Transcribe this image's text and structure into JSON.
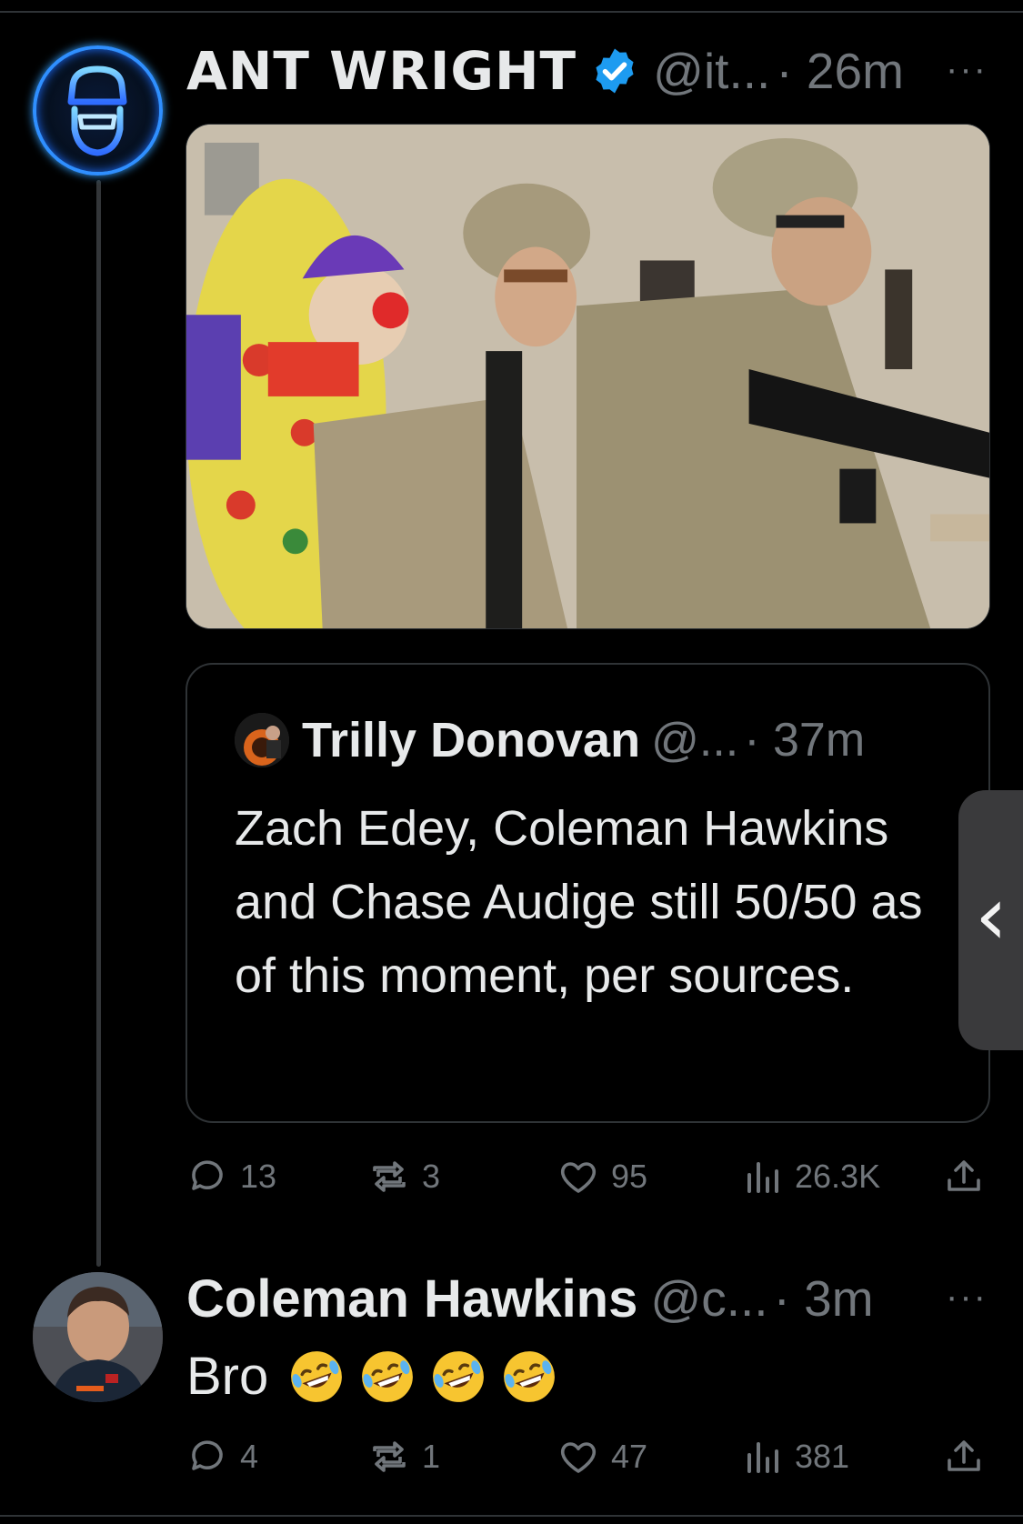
{
  "tweet": {
    "author_name": "ANT WRIGHT",
    "handle": "@it...",
    "time": "· 26m",
    "more_label": "···",
    "media_alt": "clown-with-soldiers-photo",
    "quote": {
      "author_name": "Trilly Donovan",
      "handle": "@...",
      "time": "· 37m",
      "text": "Zach Edey, Coleman Hawkins and Chase Audige still 50/50 as of this moment, per sources."
    },
    "stats": {
      "replies": "13",
      "reposts": "3",
      "likes": "95",
      "views": "26.3K"
    }
  },
  "reply": {
    "author_name": "Coleman Hawkins",
    "handle": "@c...",
    "time": "· 3m",
    "more_label": "···",
    "text": "Bro",
    "emoji_count": 4,
    "stats": {
      "replies": "4",
      "reposts": "1",
      "likes": "47",
      "views": "381"
    }
  },
  "side_handle": {
    "glyph": "‹"
  },
  "colors": {
    "background": "#000000",
    "text": "#e7e9ea",
    "muted": "#71767b",
    "verified": "#1d9bf0",
    "border": "#2f3336"
  },
  "icons": [
    "reply-icon",
    "repost-icon",
    "like-icon",
    "views-icon",
    "share-icon",
    "verified-badge-icon",
    "more-icon"
  ]
}
